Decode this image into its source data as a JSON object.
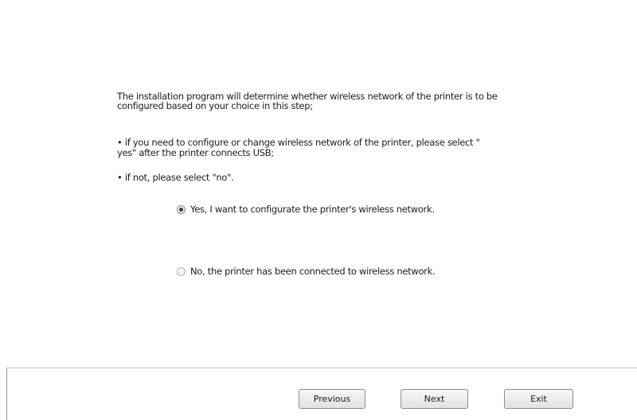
{
  "intro": {
    "line1": "The installation program will determine whether wireless network of the printer is to be",
    "line2": "configured based on your choice in this step;"
  },
  "bullets": {
    "b1_line1": "• if you need to configure or change wireless network of the printer, please select \"",
    "b1_line2": "yes\" after the printer connects USB;",
    "b2": "• if not, please select \"no\"."
  },
  "options": [
    {
      "label": "Yes, I want to configurate the printer's wireless network.",
      "selected": true
    },
    {
      "label": "No, the printer has been connected to wireless network.",
      "selected": false
    }
  ],
  "buttons": {
    "previous": "Previous",
    "next": "Next",
    "exit": "Exit"
  }
}
